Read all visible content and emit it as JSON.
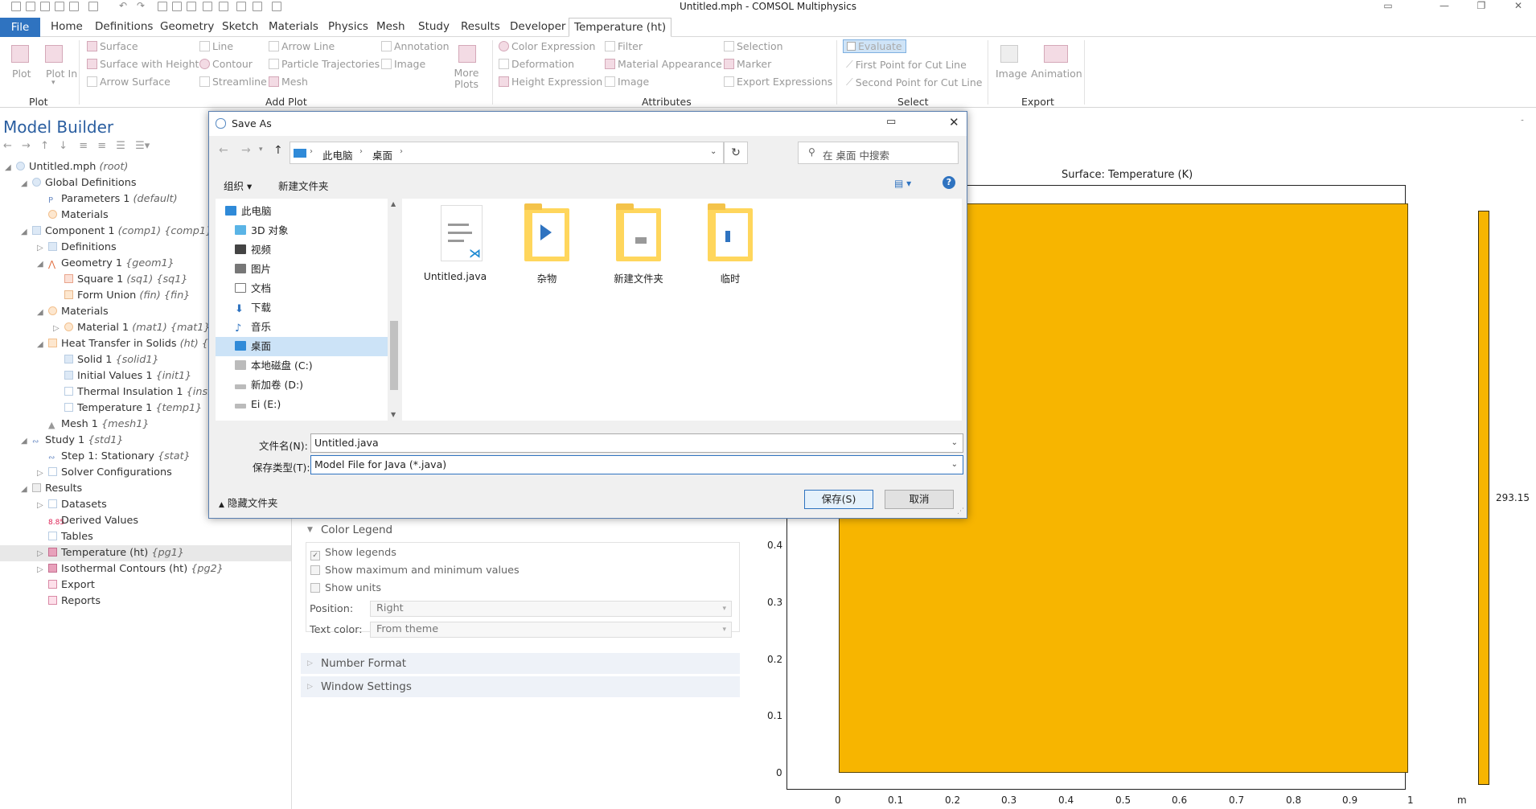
{
  "window": {
    "title": "Untitled.mph - COMSOL Multiphysics"
  },
  "menu": {
    "file": "File",
    "tabs": [
      "Home",
      "Definitions",
      "Geometry",
      "Sketch",
      "Materials",
      "Physics",
      "Mesh",
      "Study",
      "Results",
      "Developer",
      "Temperature (ht)"
    ],
    "active_tab": "Temperature (ht)"
  },
  "ribbon": {
    "plot": {
      "plot": "Plot",
      "plot_in": "Plot In",
      "group": "Plot"
    },
    "add_plot": {
      "items": [
        "Surface",
        "Line",
        "Arrow Line",
        "Annotation",
        "Surface with Height",
        "Contour",
        "Particle Trajectories",
        "Image",
        "Arrow Surface",
        "Streamline",
        "Mesh"
      ],
      "more_plots": "More Plots",
      "group": "Add Plot"
    },
    "attributes": {
      "items": [
        "Color Expression",
        "Filter",
        "Deformation",
        "Material Appearance",
        "Height Expression",
        "Image"
      ],
      "group": "Attributes"
    },
    "select": {
      "items": [
        "Selection",
        "Marker",
        "Export Expressions",
        "Evaluate",
        "First Point for Cut Line",
        "Second Point for Cut Line"
      ],
      "group": "Select"
    },
    "export": {
      "image": "Image",
      "animation": "Animation",
      "group": "Export"
    }
  },
  "model_builder": {
    "title": "Model Builder",
    "tree": [
      {
        "label": "Untitled.mph",
        "tag": "(root)"
      },
      {
        "label": "Global Definitions",
        "tag": ""
      },
      {
        "label": "Parameters 1",
        "tag": "(default)"
      },
      {
        "label": "Materials",
        "tag": ""
      },
      {
        "label": "Component 1",
        "tag": "(comp1) {comp1}"
      },
      {
        "label": "Definitions",
        "tag": ""
      },
      {
        "label": "Geometry 1",
        "tag": "{geom1}"
      },
      {
        "label": "Square 1",
        "tag": "(sq1) {sq1}"
      },
      {
        "label": "Form Union",
        "tag": "(fin) {fin}"
      },
      {
        "label": "Materials",
        "tag": ""
      },
      {
        "label": "Material 1",
        "tag": "(mat1) {mat1}"
      },
      {
        "label": "Heat Transfer in Solids",
        "tag": "(ht) {ht}"
      },
      {
        "label": "Solid 1",
        "tag": "{solid1}"
      },
      {
        "label": "Initial Values 1",
        "tag": "{init1}"
      },
      {
        "label": "Thermal Insulation 1",
        "tag": "{ins1}"
      },
      {
        "label": "Temperature 1",
        "tag": "{temp1}"
      },
      {
        "label": "Mesh 1",
        "tag": "{mesh1}"
      },
      {
        "label": "Study 1",
        "tag": "{std1}"
      },
      {
        "label": "Step 1: Stationary",
        "tag": "{stat}"
      },
      {
        "label": "Solver Configurations",
        "tag": ""
      },
      {
        "label": "Results",
        "tag": ""
      },
      {
        "label": "Datasets",
        "tag": ""
      },
      {
        "label": "Derived Values",
        "tag": ""
      },
      {
        "label": "Tables",
        "tag": ""
      },
      {
        "label": "Temperature (ht)",
        "tag": "{pg1}"
      },
      {
        "label": "Isothermal Contours (ht)",
        "tag": "{pg2}"
      },
      {
        "label": "Export",
        "tag": ""
      },
      {
        "label": "Reports",
        "tag": ""
      }
    ]
  },
  "settings": {
    "color_legend": "Color Legend",
    "show_legends": "Show legends",
    "show_maxmin": "Show maximum and minimum values",
    "show_units": "Show units",
    "position_label": "Position:",
    "position_value": "Right",
    "text_color_label": "Text color:",
    "text_color_value": "From theme",
    "number_format": "Number Format",
    "window_settings": "Window Settings"
  },
  "graphics": {
    "title": "Surface: Temperature (K)",
    "x_ticks": [
      "0",
      "0.1",
      "0.2",
      "0.3",
      "0.4",
      "0.5",
      "0.6",
      "0.7",
      "0.8",
      "0.9",
      "1"
    ],
    "y_ticks": [
      "0",
      "0.1",
      "0.2",
      "0.3",
      "0.4"
    ],
    "x_unit": "m",
    "colorbar_value": "293.15",
    "fill_color": "#f7b500"
  },
  "dialog": {
    "title": "Save As",
    "breadcrumb": [
      "此电脑",
      "桌面"
    ],
    "search_placeholder": "在 桌面 中搜索",
    "organize": "组织",
    "new_folder": "新建文件夹",
    "nav": [
      "此电脑",
      "3D 对象",
      "视频",
      "图片",
      "文档",
      "下载",
      "音乐",
      "桌面",
      "本地磁盘 (C:)",
      "新加卷 (D:)",
      "Ei (E:)"
    ],
    "files": [
      "Untitled.java",
      "杂物",
      "新建文件夹",
      "临时"
    ],
    "filename_label": "文件名(N):",
    "filename_value": "Untitled.java",
    "filetype_label": "保存类型(T):",
    "filetype_value": "Model File for Java (*.java)",
    "hide_folders": "隐藏文件夹",
    "save": "保存(S)",
    "cancel": "取消"
  }
}
